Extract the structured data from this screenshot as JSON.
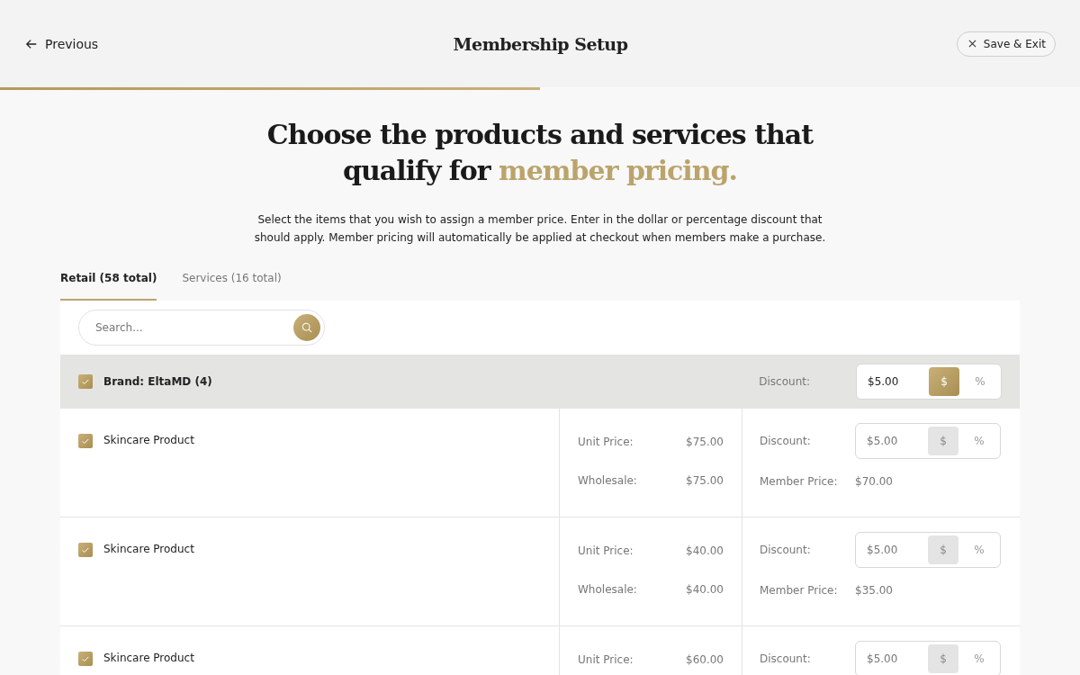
{
  "header": {
    "back": "Previous",
    "title": "Membership Setup",
    "save": "Save & Exit",
    "progress": {
      "level": 0.5
    }
  },
  "heading": {
    "line1": "Choose the products and services that",
    "line2_plain": "qualify for",
    "line2_accent": "member pricing."
  },
  "description": "Select the items that you wish to assign a member price. Enter in the dollar or percentage discount that should apply. Member pricing will automatically be applied at checkout when members make a purchase.",
  "tabs": [
    {
      "label": "Retail (58 total)",
      "selected": true
    },
    {
      "label": "Services (16 total)",
      "selected": false
    }
  ],
  "search": {
    "placeholder": "Search..."
  },
  "brand": {
    "label": "Brand: EltaMD (4)",
    "checked": true,
    "discount_label": "Discount:",
    "discount": {
      "value": "$5.00",
      "disabled": false,
      "units": [
        {
          "label": "$",
          "selected": true
        },
        {
          "label": "%",
          "selected": false
        }
      ]
    }
  },
  "products": [
    {
      "name": "Skincare Product",
      "checked": true,
      "unit_price_label": "Unit Price:",
      "unit_price": "$75.00",
      "wholesale_label": "Wholesale:",
      "wholesale": "$75.00",
      "discount_label": "Discount:",
      "discount": {
        "value": "$5.00",
        "disabled": true,
        "units": [
          {
            "label": "$",
            "selected": true
          },
          {
            "label": "%",
            "selected": false
          }
        ]
      },
      "member_price_label": "Member Price:",
      "member_price": "$70.00"
    },
    {
      "name": "Skincare Product",
      "checked": true,
      "unit_price_label": "Unit Price:",
      "unit_price": "$40.00",
      "wholesale_label": "Wholesale:",
      "wholesale": "$40.00",
      "discount_label": "Discount:",
      "discount": {
        "value": "$5.00",
        "disabled": true,
        "units": [
          {
            "label": "$",
            "selected": true
          },
          {
            "label": "%",
            "selected": false
          }
        ]
      },
      "member_price_label": "Member Price:",
      "member_price": "$35.00"
    },
    {
      "name": "Skincare Product",
      "checked": true,
      "unit_price_label": "Unit Price:",
      "unit_price": "$60.00",
      "discount_label": "Discount:",
      "discount": {
        "value": "$5.00",
        "disabled": true,
        "units": [
          {
            "label": "$",
            "selected": true
          },
          {
            "label": "%",
            "selected": false
          }
        ]
      }
    }
  ]
}
